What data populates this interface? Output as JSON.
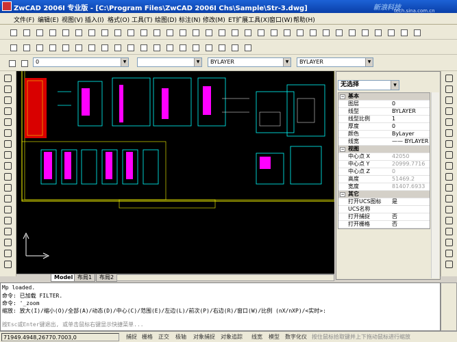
{
  "window": {
    "title": "ZwCAD 2006I 专业版 - [C:\\Program Files\\ZwCAD 2006I Chs\\Sample\\Str-3.dwg]"
  },
  "watermark": {
    "text": "新浪科技",
    "sub": "tech.sina.com.cn"
  },
  "menu": [
    "文件(F)",
    "编辑(E)",
    "视图(V)",
    "插入(I)",
    "格式(O)",
    "工具(T)",
    "绘图(D)",
    "标注(N)",
    "修改(M)",
    "ET扩展工具(X)",
    "窗口(W)",
    "帮助(H)"
  ],
  "layer_toolbar": {
    "layer_value": "0",
    "color_value": "",
    "linetype_value": "BYLAYER",
    "lineweight_value": "BYLAYER"
  },
  "layout_tabs": [
    "Model",
    "布局1",
    "布局2"
  ],
  "properties": {
    "selection": "无选择",
    "categories": [
      {
        "name": "基本",
        "rows": [
          {
            "key": "图层",
            "value": "0"
          },
          {
            "key": "线型",
            "value": "BYLAYER"
          },
          {
            "key": "线型比例",
            "value": "1"
          },
          {
            "key": "厚度",
            "value": "0"
          },
          {
            "key": "颜色",
            "value": "ByLayer"
          },
          {
            "key": "线宽",
            "value": "—— BYLAYER"
          }
        ]
      },
      {
        "name": "视图",
        "rows": [
          {
            "key": "中心点 X",
            "value": "42050"
          },
          {
            "key": "中心点 Y",
            "value": "20999.7716"
          },
          {
            "key": "中心点 Z",
            "value": "0"
          },
          {
            "key": "高度",
            "value": "51469.2"
          },
          {
            "key": "宽度",
            "value": "81407.6933"
          }
        ]
      },
      {
        "name": "其它",
        "rows": [
          {
            "key": "打开UCS图标",
            "value": "是"
          },
          {
            "key": "UCS名称",
            "value": ""
          },
          {
            "key": "打开捕捉",
            "value": "否"
          },
          {
            "key": "打开栅格",
            "value": "否"
          }
        ]
      }
    ]
  },
  "command": {
    "lines": [
      "Mp loaded.",
      "命令:   已加载 FILTER.",
      "命令:  '_zoom",
      "缩放: 放大(I)/缩小(O)/全部(A)/动态(D)/中心(C)/范围(E)/左边(L)/前次(P)/右边(R)/窗口(W)/比例 (nX/nXP)/<实时>:",
      "按Esc或Enter键退出, 或单击鼠标右键显示快捷菜单..."
    ]
  },
  "status": {
    "coords": "71949.4948,26770.7003,0",
    "buttons": [
      "捕捉",
      "栅格",
      "正交",
      "极轴",
      "对象捕捉",
      "对象追踪",
      "线宽",
      "模型",
      "数字化仪"
    ],
    "hint": "按住鼠标拾取键并上下拖动鼠标进行缩放"
  },
  "colors": {
    "title_bar": "#0a3fa8",
    "canvas": "#000000",
    "drawing_yellow": "#ffff00",
    "drawing_cyan": "#00ffff",
    "drawing_magenta": "#ff00ff"
  }
}
